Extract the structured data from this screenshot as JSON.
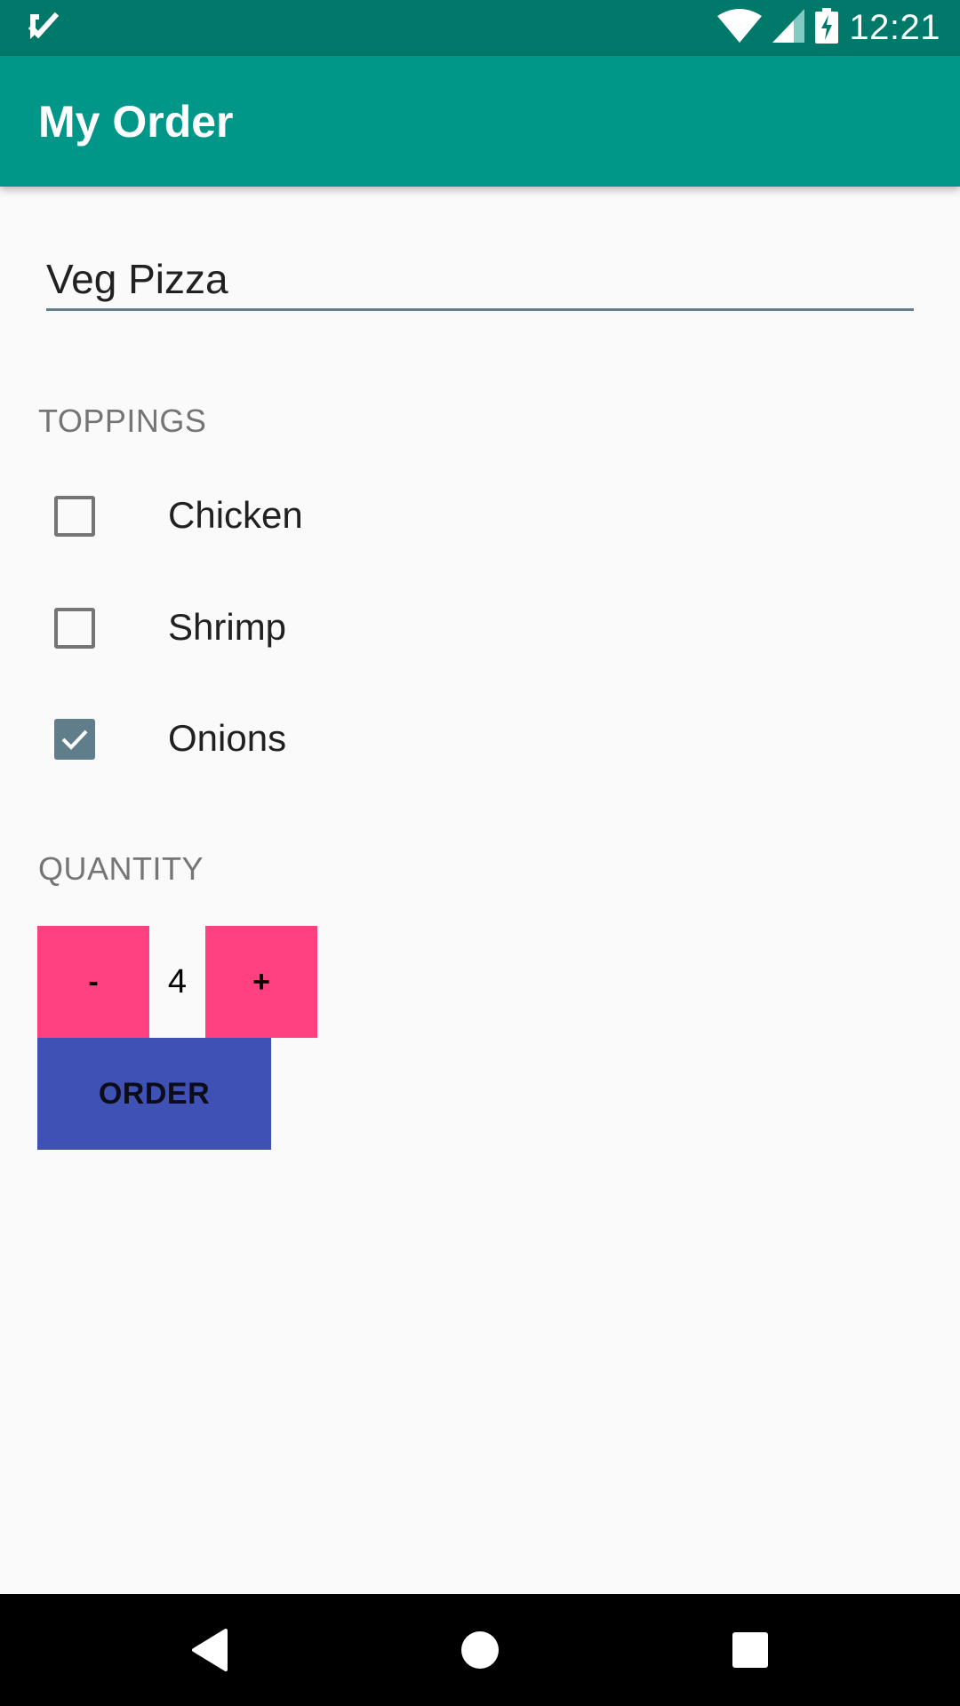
{
  "status_bar": {
    "time": "12:21",
    "icons": [
      "notification-check-icon",
      "wifi-icon",
      "signal-icon",
      "battery-charging-icon"
    ]
  },
  "app_bar": {
    "title": "My Order"
  },
  "order": {
    "item_name": "Veg Pizza",
    "toppings_label": "TOPPINGS",
    "toppings": [
      {
        "label": "Chicken",
        "checked": false
      },
      {
        "label": "Shrimp",
        "checked": false
      },
      {
        "label": "Onions",
        "checked": true
      }
    ],
    "quantity_label": "QUANTITY",
    "quantity": "4",
    "minus_label": "-",
    "plus_label": "+",
    "order_label": "ORDER"
  },
  "colors": {
    "status_bar": "#00796b",
    "app_bar": "#009688",
    "accent": "#ff4081",
    "primary_button": "#3f51b5",
    "checkbox_checked": "#607d8b"
  },
  "nav_bar": {
    "icons": [
      "back-icon",
      "home-icon",
      "recents-icon"
    ]
  }
}
